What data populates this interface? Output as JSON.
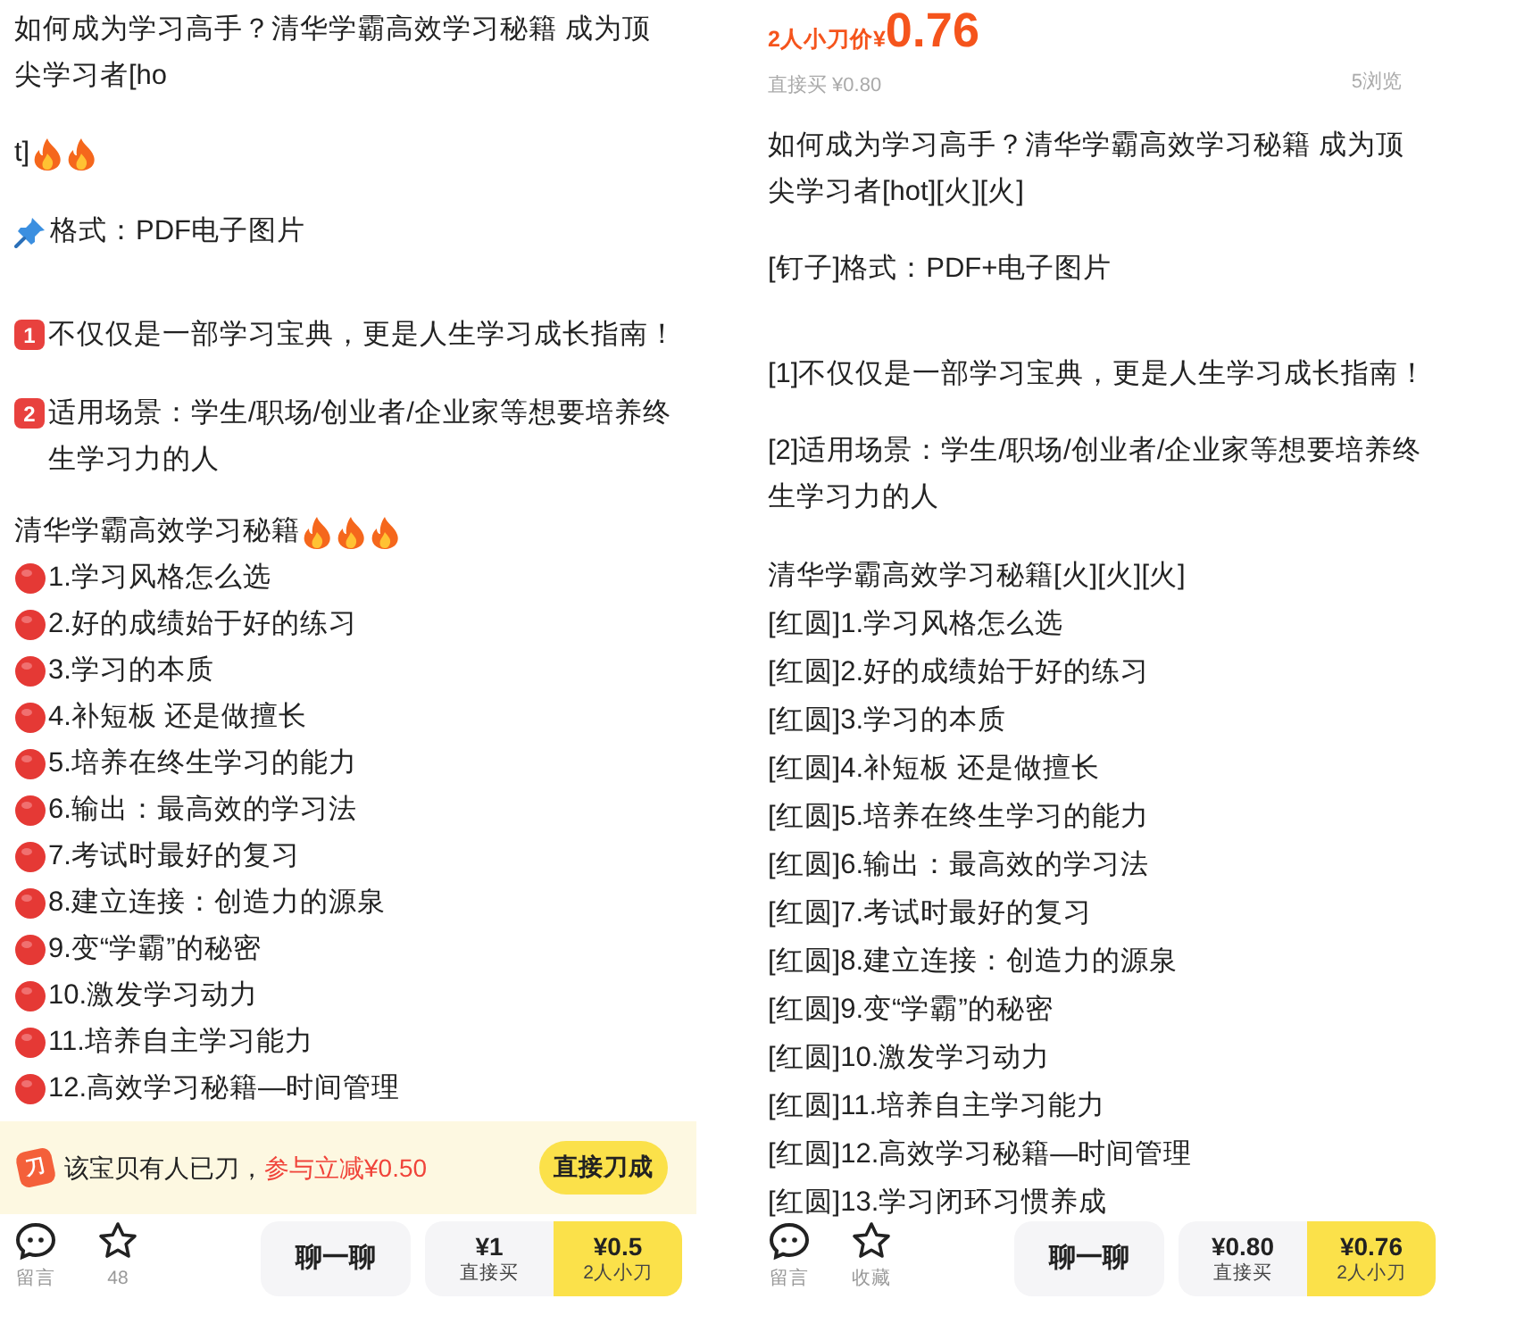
{
  "left": {
    "lines": [
      {
        "text": "如何成为学习高手？清华学霸高效学习秘籍 成为顶尖学习者[ho"
      },
      {
        "text": "t]",
        "trail": [
          {
            "kind": "fire"
          },
          {
            "kind": "fire"
          }
        ]
      },
      {
        "lead": {
          "kind": "pin"
        },
        "text": "格式：PDF电子图片"
      },
      {
        "lead": {
          "kind": "keycap",
          "label": "1"
        },
        "text": "不仅仅是一部学习宝典，更是人生学习成长指南！"
      },
      {
        "lead": {
          "kind": "keycap",
          "label": "2"
        },
        "text": "适用场景：学生/职场/创业者/企业家等想要培养终生学习力的人"
      },
      {
        "text": "清华学霸高效学习秘籍",
        "trail": [
          {
            "kind": "fire"
          },
          {
            "kind": "fire"
          },
          {
            "kind": "fire"
          }
        ]
      },
      {
        "lead": {
          "kind": "red_dot"
        },
        "text": "1.学习风格怎么选"
      },
      {
        "lead": {
          "kind": "red_dot"
        },
        "text": "2.好的成绩始于好的练习"
      },
      {
        "lead": {
          "kind": "red_dot"
        },
        "text": "3.学习的本质"
      },
      {
        "lead": {
          "kind": "red_dot"
        },
        "text": "4.补短板 还是做擅长"
      },
      {
        "lead": {
          "kind": "red_dot"
        },
        "text": "5.培养在终生学习的能力"
      },
      {
        "lead": {
          "kind": "red_dot"
        },
        "text": "6.输出：最高效的学习法"
      },
      {
        "lead": {
          "kind": "red_dot"
        },
        "text": "7.考试时最好的复习"
      },
      {
        "lead": {
          "kind": "red_dot"
        },
        "text": "8.建立连接：创造力的源泉"
      },
      {
        "lead": {
          "kind": "red_dot"
        },
        "text": "9.变“学霸”的秘密"
      },
      {
        "lead": {
          "kind": "red_dot"
        },
        "text": "10.激发学习动力"
      },
      {
        "lead": {
          "kind": "red_dot"
        },
        "text": "11.培养自主学习能力"
      },
      {
        "lead": {
          "kind": "red_dot"
        },
        "text": "12.高效学习秘籍—时间管理"
      }
    ],
    "banner": {
      "icon_label": "刀",
      "text": "该宝贝有人已刀，",
      "highlight": "参与立减¥0.50",
      "button": "直接刀成"
    },
    "bottom_bar": {
      "actions": [
        {
          "kind": "comment",
          "label": "留言"
        },
        {
          "kind": "star",
          "label": "48"
        }
      ],
      "chat_button": "聊一聊",
      "buy_options": [
        {
          "kind": "direct",
          "price": "¥1",
          "label": "直接买"
        },
        {
          "kind": "bargain",
          "price": "¥0.5",
          "label": "2人小刀"
        }
      ]
    }
  },
  "right": {
    "price_label": "2人小刀价¥",
    "price": "0.76",
    "direct_price": "直接买 ¥0.80",
    "views": "5浏览",
    "lines": [
      {
        "text": "如何成为学习高手？清华学霸高效学习秘籍 成为顶尖学习者[hot][火][火]"
      },
      {
        "text": "[钉子]格式：PDF+电子图片"
      },
      {
        "text": "[1]不仅仅是一部学习宝典，更是人生学习成长指南！"
      },
      {
        "text": "[2]适用场景：学生/职场/创业者/企业家等想要培养终生学习力的人"
      },
      {
        "text": "清华学霸高效学习秘籍[火][火][火]"
      },
      {
        "text": "[红圆]1.学习风格怎么选"
      },
      {
        "text": "[红圆]2.好的成绩始于好的练习"
      },
      {
        "text": "[红圆]3.学习的本质"
      },
      {
        "text": "[红圆]4.补短板 还是做擅长"
      },
      {
        "text": "[红圆]5.培养在终生学习的能力"
      },
      {
        "text": "[红圆]6.输出：最高效的学习法"
      },
      {
        "text": "[红圆]7.考试时最好的复习"
      },
      {
        "text": "[红圆]8.建立连接：创造力的源泉"
      },
      {
        "text": "[红圆]9.变“学霸”的秘密"
      },
      {
        "text": "[红圆]10.激发学习动力"
      },
      {
        "text": "[红圆]11.培养自主学习能力"
      },
      {
        "text": "[红圆]12.高效学习秘籍—时间管理"
      },
      {
        "text": "[红圆]13.学习闭环习惯养成"
      }
    ],
    "bottom_bar": {
      "actions": [
        {
          "kind": "comment",
          "label": "留言"
        },
        {
          "kind": "star",
          "label": "收藏"
        }
      ],
      "chat_button": "聊一聊",
      "buy_options": [
        {
          "kind": "direct",
          "price": "¥0.80",
          "label": "直接买"
        },
        {
          "kind": "bargain",
          "price": "¥0.76",
          "label": "2人小刀"
        }
      ]
    }
  }
}
